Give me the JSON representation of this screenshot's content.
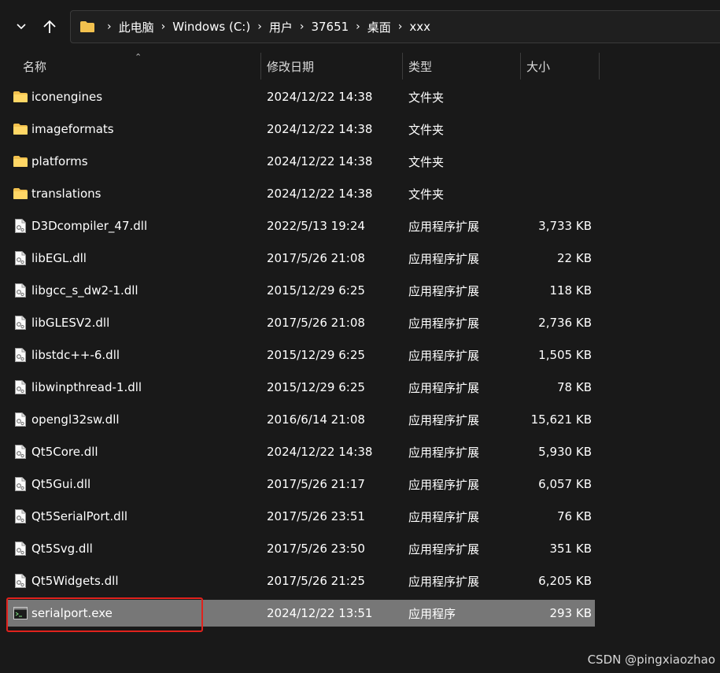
{
  "nav": {
    "back_icon": "chevron-down-icon",
    "up_icon": "up-arrow-icon"
  },
  "address_bar": {
    "folder_icon": "folder-icon",
    "crumbs": [
      "此电脑",
      "Windows (C:)",
      "用户",
      "37651",
      "桌面",
      "xxx"
    ]
  },
  "columns": {
    "name": "名称",
    "date": "修改日期",
    "type": "类型",
    "size": "大小"
  },
  "files": [
    {
      "name": "iconengines",
      "date": "2024/12/22 14:38",
      "type": "文件夹",
      "size": "",
      "icon": "folder-icon"
    },
    {
      "name": "imageformats",
      "date": "2024/12/22 14:38",
      "type": "文件夹",
      "size": "",
      "icon": "folder-icon"
    },
    {
      "name": "platforms",
      "date": "2024/12/22 14:38",
      "type": "文件夹",
      "size": "",
      "icon": "folder-icon"
    },
    {
      "name": "translations",
      "date": "2024/12/22 14:38",
      "type": "文件夹",
      "size": "",
      "icon": "folder-icon"
    },
    {
      "name": "D3Dcompiler_47.dll",
      "date": "2022/5/13 19:24",
      "type": "应用程序扩展",
      "size": "3,733 KB",
      "icon": "dll-file-icon"
    },
    {
      "name": "libEGL.dll",
      "date": "2017/5/26 21:08",
      "type": "应用程序扩展",
      "size": "22 KB",
      "icon": "dll-file-icon"
    },
    {
      "name": "libgcc_s_dw2-1.dll",
      "date": "2015/12/29 6:25",
      "type": "应用程序扩展",
      "size": "118 KB",
      "icon": "dll-file-icon"
    },
    {
      "name": "libGLESV2.dll",
      "date": "2017/5/26 21:08",
      "type": "应用程序扩展",
      "size": "2,736 KB",
      "icon": "dll-file-icon"
    },
    {
      "name": "libstdc++-6.dll",
      "date": "2015/12/29 6:25",
      "type": "应用程序扩展",
      "size": "1,505 KB",
      "icon": "dll-file-icon"
    },
    {
      "name": "libwinpthread-1.dll",
      "date": "2015/12/29 6:25",
      "type": "应用程序扩展",
      "size": "78 KB",
      "icon": "dll-file-icon"
    },
    {
      "name": "opengl32sw.dll",
      "date": "2016/6/14 21:08",
      "type": "应用程序扩展",
      "size": "15,621 KB",
      "icon": "dll-file-icon"
    },
    {
      "name": "Qt5Core.dll",
      "date": "2024/12/22 14:38",
      "type": "应用程序扩展",
      "size": "5,930 KB",
      "icon": "dll-file-icon"
    },
    {
      "name": "Qt5Gui.dll",
      "date": "2017/5/26 21:17",
      "type": "应用程序扩展",
      "size": "6,057 KB",
      "icon": "dll-file-icon"
    },
    {
      "name": "Qt5SerialPort.dll",
      "date": "2017/5/26 23:51",
      "type": "应用程序扩展",
      "size": "76 KB",
      "icon": "dll-file-icon"
    },
    {
      "name": "Qt5Svg.dll",
      "date": "2017/5/26 23:50",
      "type": "应用程序扩展",
      "size": "351 KB",
      "icon": "dll-file-icon"
    },
    {
      "name": "Qt5Widgets.dll",
      "date": "2017/5/26 21:25",
      "type": "应用程序扩展",
      "size": "6,205 KB",
      "icon": "dll-file-icon"
    },
    {
      "name": "serialport.exe",
      "date": "2024/12/22 13:51",
      "type": "应用程序",
      "size": "293 KB",
      "icon": "exe-file-icon",
      "selected": true
    }
  ],
  "colors": {
    "background": "#191919",
    "selected_row": "#777777",
    "highlight_box": "#e0221d",
    "folder": "#f2c14e"
  },
  "watermark": "CSDN @pingxiaozhao"
}
